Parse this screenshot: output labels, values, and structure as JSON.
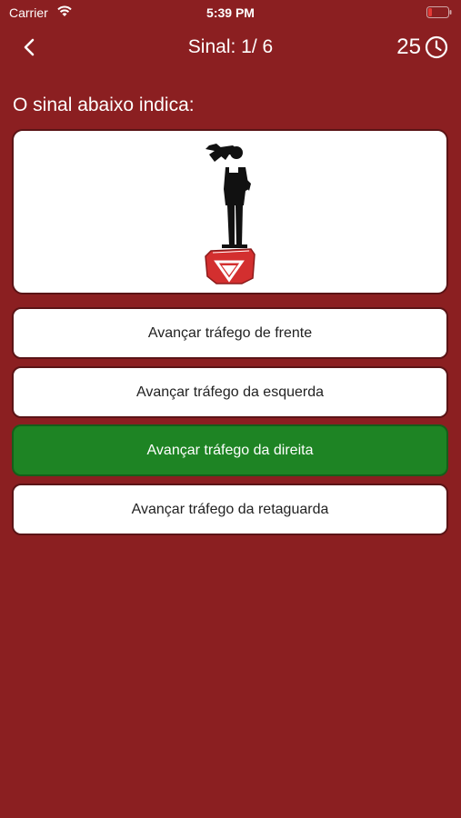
{
  "status": {
    "carrier": "Carrier",
    "time": "5:39 PM",
    "battery_color": "#E53935"
  },
  "nav": {
    "title": "Sinal: 1/ 6",
    "timer": "25"
  },
  "question": {
    "label": "O sinal abaixo indica:",
    "sign_image": "traffic-officer-on-podium"
  },
  "options": [
    {
      "label": "Avançar tráfego de frente",
      "state": "default"
    },
    {
      "label": "Avançar tráfego da esquerda",
      "state": "default"
    },
    {
      "label": "Avançar tráfego da direita",
      "state": "correct"
    },
    {
      "label": "Avançar tráfego da retaguarda",
      "state": "default"
    }
  ],
  "colors": {
    "background": "#8B1F21",
    "correct": "#1E8424",
    "option": "#FFFFFF"
  }
}
